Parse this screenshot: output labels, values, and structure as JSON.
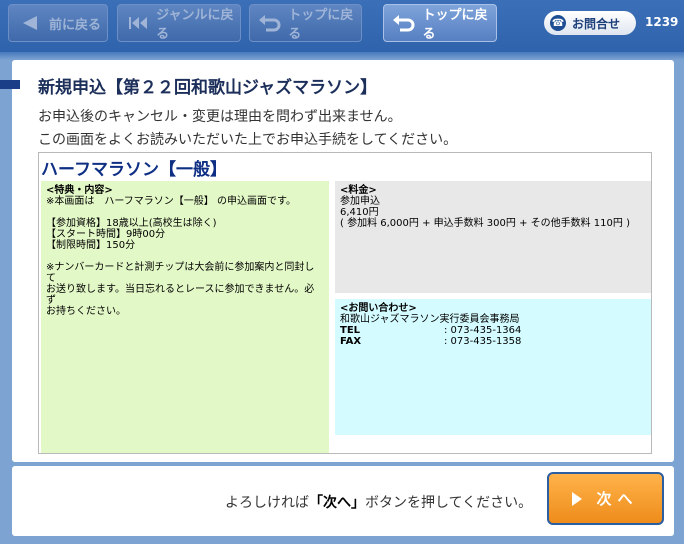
{
  "nav": {
    "back_label": "前に戻る",
    "genre_label": "ジャンルに戻る",
    "top_label_disabled": "トップに戻る",
    "top_label": "トップに戻る"
  },
  "header": {
    "inquiry_label": "お問合せ",
    "terminal_id": "1239"
  },
  "page": {
    "title": "新規申込【第２２回和歌山ジャズマラソン】",
    "subtitle_1": "お申込後のキャンセル・変更は理由を問わず出来ません。",
    "subtitle_2": "この画面をよくお読みいただいた上でお申込手続をしてください。"
  },
  "plan": {
    "name": "ハーフマラソン【一般】",
    "benefit_head": "<特典・内容>",
    "benefit_line_1": "※本画面は　ハーフマラソン【一般】 の申込画面です。",
    "benefit_line_2": "【参加資格】18歳以上(高校生は除く)",
    "benefit_line_3": "【スタート時間】9時00分",
    "benefit_line_4": "【制限時間】150分",
    "benefit_line_5": "※ナンバーカードと計測チップは大会前に参加案内と同封して",
    "benefit_line_6": "お送り致します。当日忘れるとレースに参加できません。必ず",
    "benefit_line_7": "お持ちください。",
    "fee_head": "<料金>",
    "fee_line_1": "参加申込",
    "fee_line_2": "6,410円",
    "fee_line_3": "( 参加料 6,000円 + 申込手数料 300円 + その他手数料 110円 )",
    "contact_head": "<お問い合わせ>",
    "contact_org": "和歌山ジャズマラソン実行委員会事務局",
    "tel_label": "TEL",
    "tel_value": ": 073-435-1364",
    "fax_label": "FAX",
    "fax_value": ": 073-435-1358"
  },
  "footer": {
    "instruction_pre": "よろしければ",
    "instruction_key": "「次へ」",
    "instruction_post": "ボタンを押してください。",
    "next_label": "次へ"
  },
  "colors": {
    "accent": "#1b3e88",
    "benefit_bg": "#e3f8c7",
    "fee_bg": "#e8e8e8",
    "contact_bg": "#d4fbff",
    "next_button": "#f29a2e"
  }
}
